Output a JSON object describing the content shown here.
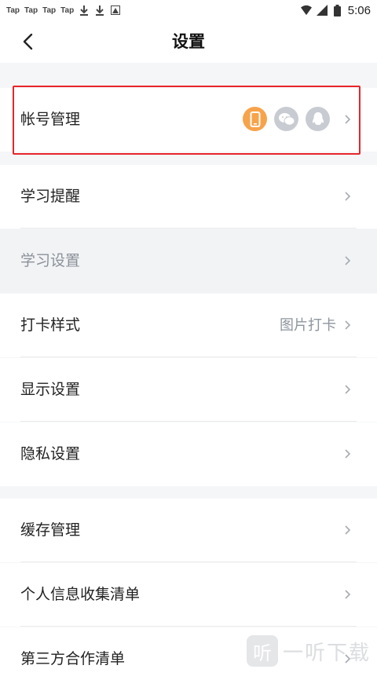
{
  "status_bar": {
    "left_labels": [
      "Tap",
      "Tap",
      "Tap",
      "Tap"
    ],
    "time": "5:06",
    "icons": [
      "download-icon",
      "download-icon",
      "image-notification-icon",
      "wifi-icon",
      "cellular-signal-icon",
      "battery-icon"
    ]
  },
  "header": {
    "title": "设置",
    "back_icon": "chevron-left-icon"
  },
  "sections": [
    {
      "items": [
        {
          "label": "帐号管理",
          "highlighted": true,
          "account_icons": [
            {
              "name": "phone-icon",
              "color": "#f7a34b"
            },
            {
              "name": "wechat-icon",
              "color": "#c8ccd2"
            },
            {
              "name": "qq-icon",
              "color": "#c8ccd2"
            }
          ]
        }
      ]
    },
    {
      "items": [
        {
          "label": "学习提醒"
        },
        {
          "label": "学习设置",
          "disabled": true
        },
        {
          "label": "打卡样式",
          "value": "图片打卡"
        },
        {
          "label": "显示设置"
        },
        {
          "label": "隐私设置"
        }
      ]
    },
    {
      "items": [
        {
          "label": "缓存管理"
        },
        {
          "label": "个人信息收集清单"
        },
        {
          "label": "第三方合作清单"
        }
      ]
    }
  ],
  "watermark": {
    "text": "一听下载",
    "logo_glyph": "听"
  },
  "colors": {
    "highlight_border": "#e8252a",
    "accent_orange": "#f7a34b",
    "inactive_icon": "#c8ccd2",
    "secondary_text": "#8e959e"
  }
}
